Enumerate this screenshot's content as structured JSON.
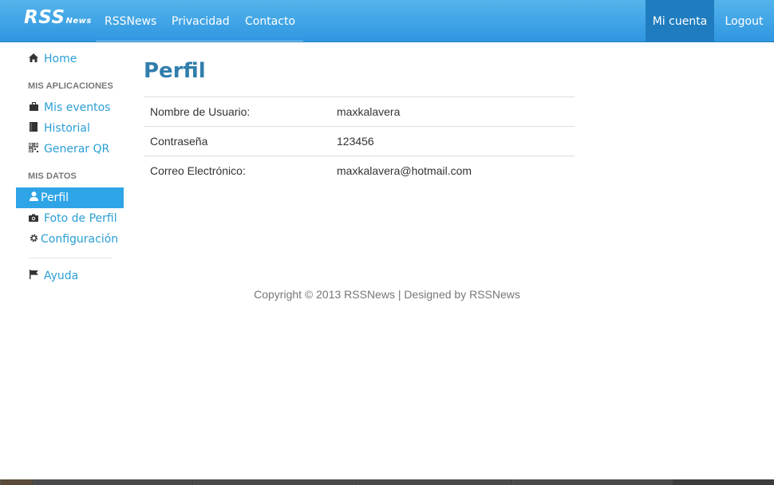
{
  "navbar": {
    "brand": "RSS",
    "brand_sub": "News",
    "links": [
      "RSSNews",
      "Privacidad",
      "Contacto"
    ],
    "account": "Mi cuenta",
    "logout": "Logout"
  },
  "sidebar": {
    "home": "Home",
    "apps_header": "MIS APLICACIONES",
    "apps": [
      "Mis eventos",
      "Historial",
      "Generar QR"
    ],
    "data_header": "MIS DATOS",
    "data_items": [
      "Perfil",
      "Foto de Perfil",
      "Configuración"
    ],
    "help": "Ayuda"
  },
  "main": {
    "title": "Perfil",
    "rows": [
      {
        "label": "Nombre de Usuario:",
        "value": "maxkalavera"
      },
      {
        "label": "Contraseña",
        "value": "123456"
      },
      {
        "label": "Correo Electrónico:",
        "value": "maxkalavera@hotmail.com"
      }
    ]
  },
  "footer": {
    "text": "Copyright © 2013 RSSNews | Designed by RSSNews"
  },
  "colors": {
    "navbar": "#2f96e0",
    "accent": "#2fa4e7",
    "title": "#317eac",
    "active_nav": "#1f7dbf"
  }
}
